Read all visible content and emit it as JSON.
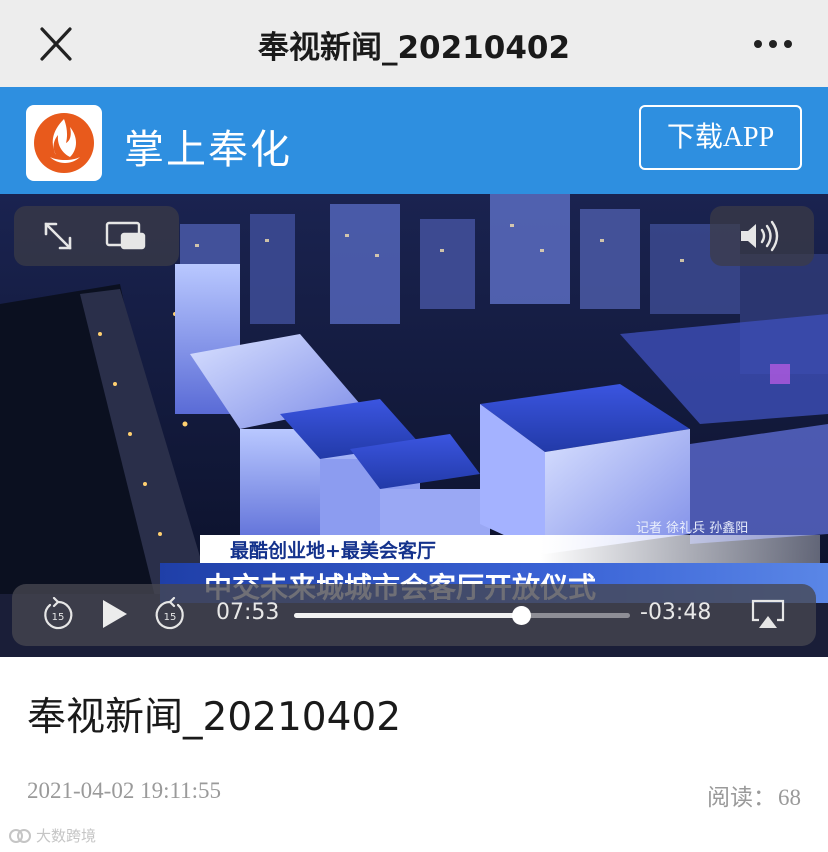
{
  "topbar": {
    "title": "奉视新闻_20210402",
    "close_icon": "close-icon",
    "more_icon": "more-horizontal-icon"
  },
  "banner": {
    "app_name": "掌上奉化",
    "download_label": "下载APP",
    "logo_icon": "flame-logo-icon",
    "color": "#2e8fe0"
  },
  "video": {
    "icons": [
      "expand-icon",
      "picture-in-picture-icon",
      "volume-icon",
      "rewind-15-icon",
      "play-icon",
      "forward-15-icon",
      "airplay-icon"
    ],
    "overlay_sub": "最酷创业地+最美会客厅",
    "overlay_main": "中交未来城城市会客厅开放仪式",
    "reporter": "记者  徐礼兵  孙鑫阳",
    "elapsed": "07:53",
    "remaining": "-03:48",
    "progress": 0.675
  },
  "article": {
    "title": "奉视新闻_20210402",
    "date": "2021-04-02 19:11:55",
    "read_label": "阅读：",
    "read_count": "68"
  },
  "watermark": "大数跨境"
}
